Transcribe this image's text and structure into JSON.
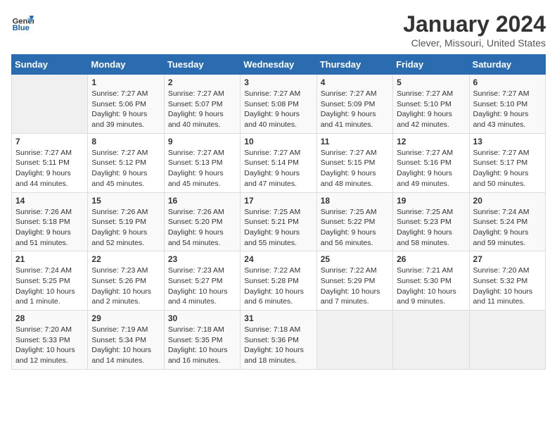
{
  "header": {
    "logo_general": "General",
    "logo_blue": "Blue",
    "month_title": "January 2024",
    "location": "Clever, Missouri, United States"
  },
  "weekdays": [
    "Sunday",
    "Monday",
    "Tuesday",
    "Wednesday",
    "Thursday",
    "Friday",
    "Saturday"
  ],
  "weeks": [
    [
      {
        "day": "",
        "empty": true
      },
      {
        "day": "1",
        "sunrise": "7:27 AM",
        "sunset": "5:06 PM",
        "daylight": "9 hours and 39 minutes."
      },
      {
        "day": "2",
        "sunrise": "7:27 AM",
        "sunset": "5:07 PM",
        "daylight": "9 hours and 40 minutes."
      },
      {
        "day": "3",
        "sunrise": "7:27 AM",
        "sunset": "5:08 PM",
        "daylight": "9 hours and 40 minutes."
      },
      {
        "day": "4",
        "sunrise": "7:27 AM",
        "sunset": "5:09 PM",
        "daylight": "9 hours and 41 minutes."
      },
      {
        "day": "5",
        "sunrise": "7:27 AM",
        "sunset": "5:10 PM",
        "daylight": "9 hours and 42 minutes."
      },
      {
        "day": "6",
        "sunrise": "7:27 AM",
        "sunset": "5:10 PM",
        "daylight": "9 hours and 43 minutes."
      }
    ],
    [
      {
        "day": "7",
        "sunrise": "7:27 AM",
        "sunset": "5:11 PM",
        "daylight": "9 hours and 44 minutes."
      },
      {
        "day": "8",
        "sunrise": "7:27 AM",
        "sunset": "5:12 PM",
        "daylight": "9 hours and 45 minutes."
      },
      {
        "day": "9",
        "sunrise": "7:27 AM",
        "sunset": "5:13 PM",
        "daylight": "9 hours and 45 minutes."
      },
      {
        "day": "10",
        "sunrise": "7:27 AM",
        "sunset": "5:14 PM",
        "daylight": "9 hours and 47 minutes."
      },
      {
        "day": "11",
        "sunrise": "7:27 AM",
        "sunset": "5:15 PM",
        "daylight": "9 hours and 48 minutes."
      },
      {
        "day": "12",
        "sunrise": "7:27 AM",
        "sunset": "5:16 PM",
        "daylight": "9 hours and 49 minutes."
      },
      {
        "day": "13",
        "sunrise": "7:27 AM",
        "sunset": "5:17 PM",
        "daylight": "9 hours and 50 minutes."
      }
    ],
    [
      {
        "day": "14",
        "sunrise": "7:26 AM",
        "sunset": "5:18 PM",
        "daylight": "9 hours and 51 minutes."
      },
      {
        "day": "15",
        "sunrise": "7:26 AM",
        "sunset": "5:19 PM",
        "daylight": "9 hours and 52 minutes."
      },
      {
        "day": "16",
        "sunrise": "7:26 AM",
        "sunset": "5:20 PM",
        "daylight": "9 hours and 54 minutes."
      },
      {
        "day": "17",
        "sunrise": "7:25 AM",
        "sunset": "5:21 PM",
        "daylight": "9 hours and 55 minutes."
      },
      {
        "day": "18",
        "sunrise": "7:25 AM",
        "sunset": "5:22 PM",
        "daylight": "9 hours and 56 minutes."
      },
      {
        "day": "19",
        "sunrise": "7:25 AM",
        "sunset": "5:23 PM",
        "daylight": "9 hours and 58 minutes."
      },
      {
        "day": "20",
        "sunrise": "7:24 AM",
        "sunset": "5:24 PM",
        "daylight": "9 hours and 59 minutes."
      }
    ],
    [
      {
        "day": "21",
        "sunrise": "7:24 AM",
        "sunset": "5:25 PM",
        "daylight": "10 hours and 1 minute."
      },
      {
        "day": "22",
        "sunrise": "7:23 AM",
        "sunset": "5:26 PM",
        "daylight": "10 hours and 2 minutes."
      },
      {
        "day": "23",
        "sunrise": "7:23 AM",
        "sunset": "5:27 PM",
        "daylight": "10 hours and 4 minutes."
      },
      {
        "day": "24",
        "sunrise": "7:22 AM",
        "sunset": "5:28 PM",
        "daylight": "10 hours and 6 minutes."
      },
      {
        "day": "25",
        "sunrise": "7:22 AM",
        "sunset": "5:29 PM",
        "daylight": "10 hours and 7 minutes."
      },
      {
        "day": "26",
        "sunrise": "7:21 AM",
        "sunset": "5:30 PM",
        "daylight": "10 hours and 9 minutes."
      },
      {
        "day": "27",
        "sunrise": "7:20 AM",
        "sunset": "5:32 PM",
        "daylight": "10 hours and 11 minutes."
      }
    ],
    [
      {
        "day": "28",
        "sunrise": "7:20 AM",
        "sunset": "5:33 PM",
        "daylight": "10 hours and 12 minutes."
      },
      {
        "day": "29",
        "sunrise": "7:19 AM",
        "sunset": "5:34 PM",
        "daylight": "10 hours and 14 minutes."
      },
      {
        "day": "30",
        "sunrise": "7:18 AM",
        "sunset": "5:35 PM",
        "daylight": "10 hours and 16 minutes."
      },
      {
        "day": "31",
        "sunrise": "7:18 AM",
        "sunset": "5:36 PM",
        "daylight": "10 hours and 18 minutes."
      },
      {
        "day": "",
        "empty": true
      },
      {
        "day": "",
        "empty": true
      },
      {
        "day": "",
        "empty": true
      }
    ]
  ]
}
